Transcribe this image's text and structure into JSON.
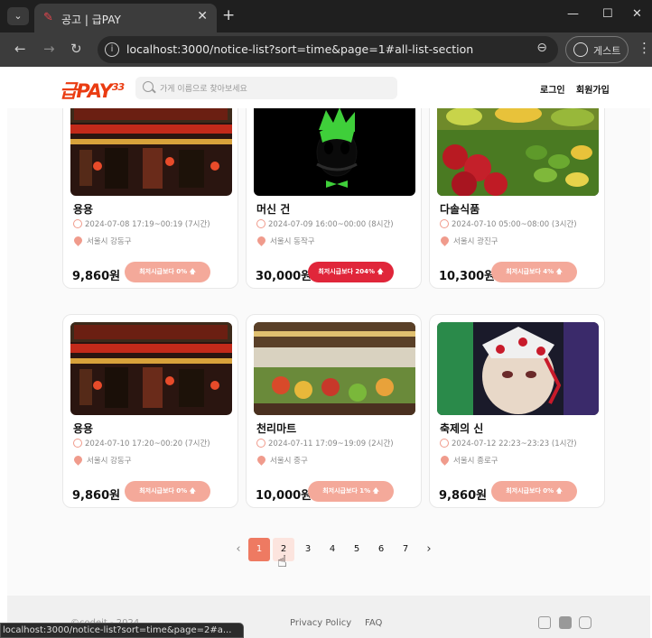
{
  "browser": {
    "tab_title": "공고 | 급PAY",
    "url": "localhost:3000/notice-list?sort=time&page=1#all-list-section",
    "guest_label": "게스트",
    "status_url": "localhost:3000/notice-list?sort=time&page=2#a..."
  },
  "header": {
    "logo": "급PAY",
    "logo_sup": "33",
    "search_placeholder": "가게 이름으로 찾아보세요",
    "login": "로그인",
    "signup": "회원가입"
  },
  "cards": [
    {
      "name": "용용",
      "time": "2024-07-08 17:19~00:19 (7시간)",
      "location": "서울시 강동구",
      "wage": "9,860원",
      "badge": "최저시급보다 0% 🡅",
      "badge_style": "light",
      "image": "restaurant-storefront"
    },
    {
      "name": "머신 건",
      "time": "2024-07-09 16:00~00:00 (8시간)",
      "location": "서울시 동작구",
      "wage": "30,000원",
      "badge": "최저시급보다 204% 🡅",
      "badge_style": "strong",
      "image": "green-skull"
    },
    {
      "name": "다솔식품",
      "time": "2024-07-10 05:00~08:00 (3시간)",
      "location": "서울시 광진구",
      "wage": "10,300원",
      "badge": "최저시급보다 4% 🡅",
      "badge_style": "light",
      "image": "fruit-stand"
    },
    {
      "name": "용용",
      "time": "2024-07-10 17:20~00:20 (7시간)",
      "location": "서울시 강동구",
      "wage": "9,860원",
      "badge": "최저시급보다 0% 🡅",
      "badge_style": "light",
      "image": "restaurant-storefront"
    },
    {
      "name": "천리마트",
      "time": "2024-07-11 17:09~19:09 (2시간)",
      "location": "서울시 중구",
      "wage": "10,000원",
      "badge": "최저시급보다 1% 🡅",
      "badge_style": "light",
      "image": "supermarket"
    },
    {
      "name": "축제의 신",
      "time": "2024-07-12 22:23~23:23 (1시간)",
      "location": "서울시 종로구",
      "wage": "9,860원",
      "badge": "최저시급보다 0% 🡅",
      "badge_style": "light",
      "image": "anime-character"
    }
  ],
  "pagination": {
    "prev": "‹",
    "pages": [
      "1",
      "2",
      "3",
      "4",
      "5",
      "6",
      "7"
    ],
    "next": "›",
    "current": "1"
  },
  "footer": {
    "copyright": "©codeit - 2024",
    "privacy": "Privacy Policy",
    "faq": "FAQ"
  },
  "colors": {
    "accent": "#ea3c12",
    "badge_light": "#f4a99a",
    "badge_strong": "#e0263a",
    "page_active": "#ee7a62"
  }
}
